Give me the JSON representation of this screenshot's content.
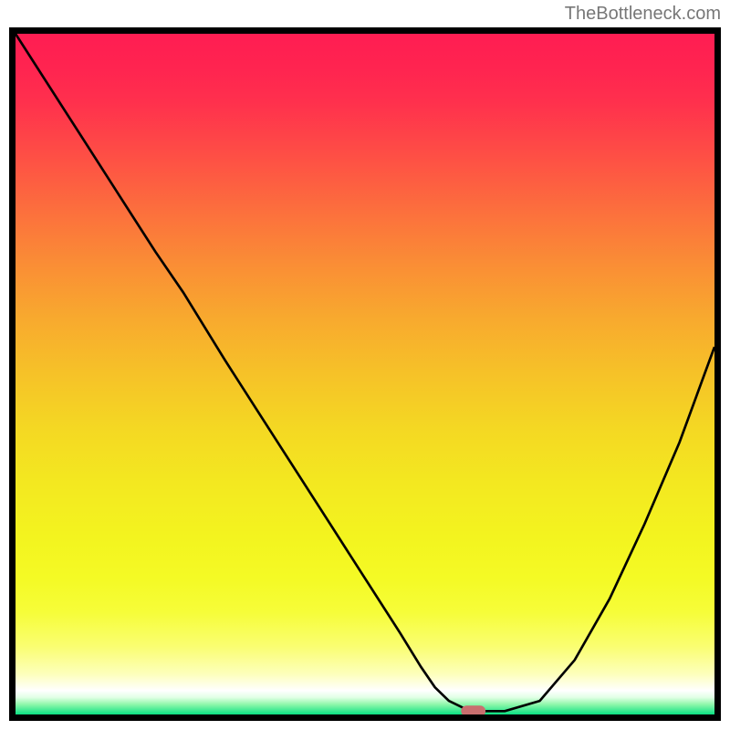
{
  "watermark": "TheBottleneck.com",
  "chart_data": {
    "type": "line",
    "title": "",
    "xlabel": "",
    "ylabel": "",
    "xlim": [
      0,
      100
    ],
    "ylim": [
      0,
      100
    ],
    "series": [
      {
        "name": "curve",
        "x": [
          0,
          5,
          10,
          15,
          20,
          24,
          30,
          35,
          40,
          45,
          50,
          55,
          58,
          60,
          62,
          64,
          66,
          70,
          75,
          80,
          85,
          90,
          95,
          100
        ],
        "values": [
          100,
          92,
          84,
          76,
          68,
          62,
          52,
          44,
          36,
          28,
          20,
          12,
          7,
          4,
          2,
          1,
          0.5,
          0.5,
          2,
          8,
          17,
          28,
          40,
          54
        ]
      }
    ],
    "marker": {
      "x": 65.5,
      "y": 0.5,
      "color": "#c96f6f",
      "width": 3.5,
      "height": 1.6
    },
    "gradient_stops": [
      {
        "offset": 0.0,
        "color": "#ff1d52"
      },
      {
        "offset": 0.05,
        "color": "#ff2450"
      },
      {
        "offset": 0.1,
        "color": "#ff304d"
      },
      {
        "offset": 0.18,
        "color": "#fe4f45"
      },
      {
        "offset": 0.26,
        "color": "#fc6f3d"
      },
      {
        "offset": 0.34,
        "color": "#fa8e35"
      },
      {
        "offset": 0.42,
        "color": "#f8aa2e"
      },
      {
        "offset": 0.5,
        "color": "#f6c228"
      },
      {
        "offset": 0.58,
        "color": "#f4d823"
      },
      {
        "offset": 0.66,
        "color": "#f3e820"
      },
      {
        "offset": 0.74,
        "color": "#f3f41f"
      },
      {
        "offset": 0.8,
        "color": "#f4fa25"
      },
      {
        "offset": 0.85,
        "color": "#f6fd39"
      },
      {
        "offset": 0.9,
        "color": "#fafe71"
      },
      {
        "offset": 0.94,
        "color": "#fdffba"
      },
      {
        "offset": 0.965,
        "color": "#ffffff"
      },
      {
        "offset": 0.975,
        "color": "#e0ffe5"
      },
      {
        "offset": 0.985,
        "color": "#90f7ab"
      },
      {
        "offset": 1.0,
        "color": "#0be183"
      }
    ]
  }
}
